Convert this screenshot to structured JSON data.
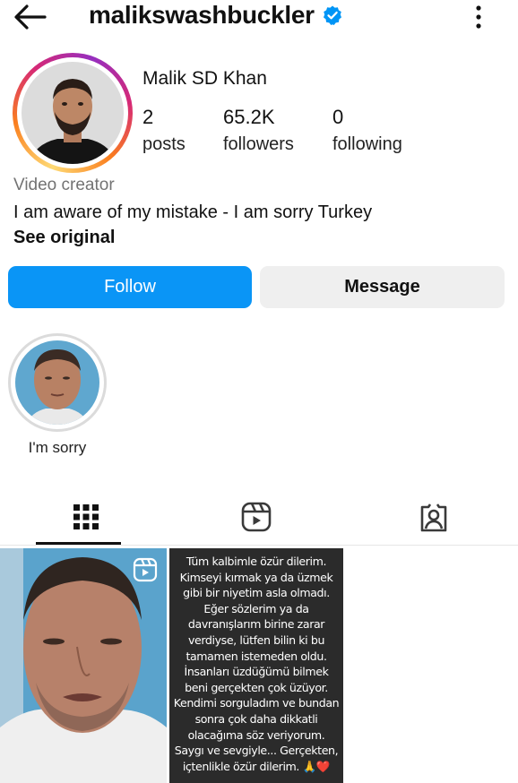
{
  "header": {
    "username": "malikswashbuckler",
    "verified": true
  },
  "profile": {
    "display_name": "Malik SD Khan",
    "stats": [
      {
        "value": "2",
        "label": "posts"
      },
      {
        "value": "65.2K",
        "label": "followers"
      },
      {
        "value": "0",
        "label": "following"
      }
    ],
    "category": "Video creator",
    "bio": "I am aware of my mistake - I am sorry Turkey",
    "see_original": "See original"
  },
  "actions": {
    "follow_label": "Follow",
    "message_label": "Message"
  },
  "highlights": [
    {
      "label": "I'm sorry"
    }
  ],
  "tabs": [
    {
      "name": "grid-icon",
      "active": true
    },
    {
      "name": "reels-icon",
      "active": false
    },
    {
      "name": "tagged-icon",
      "active": false
    }
  ],
  "posts": {
    "post2_lines": [
      "Tüm kalbimle özür dilerim.",
      "Kimseyi kırmak ya da üzmek",
      "gibi bir niyetim asla olmadı.",
      "Eğer sözlerim ya da",
      "davranışlarım birine zarar",
      "verdiyse, lütfen bilin ki bu",
      "tamamen istemeden oldu.",
      "İnsanları üzdüğümü bilmek",
      "beni gerçekten çok üzüyor.",
      "Kendimi sorguladım ve bundan",
      "sonra çok daha dikkatli",
      "olacağıma söz veriyorum.",
      "Saygı ve sevgiyle... Gerçekten,",
      "içtenlikle özür dilerim. 🙏❤️"
    ]
  },
  "colors": {
    "follow_blue": "#0a95f6",
    "message_gray": "#efefef",
    "verified_blue": "#0095f6",
    "muted_text": "#737373"
  }
}
